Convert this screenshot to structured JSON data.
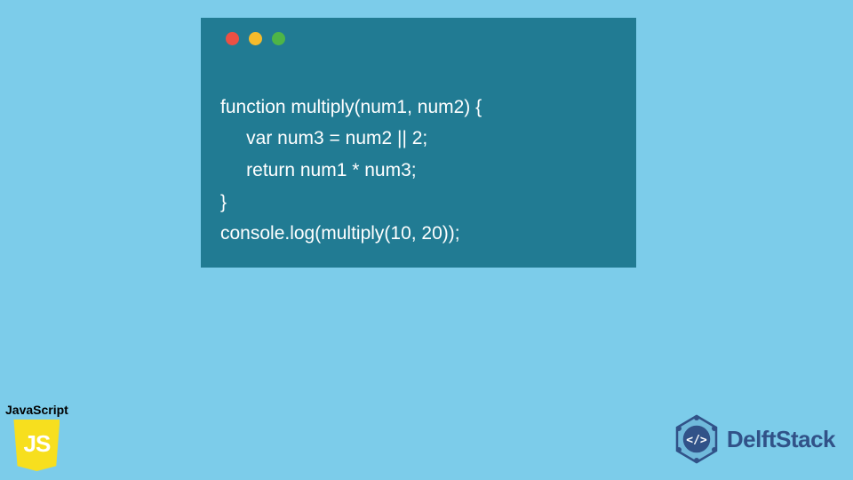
{
  "code": {
    "lines": [
      "function multiply(num1, num2) {",
      "     var num3 = num2 || 2;",
      "     return num1 * num3;",
      "}",
      "console.log(multiply(10, 20));"
    ]
  },
  "jsBadge": {
    "label": "JavaScript",
    "logoText": "JS"
  },
  "brand": {
    "name": "DelftStack"
  },
  "colors": {
    "background": "#7cccea",
    "windowBg": "#217b93",
    "codeText": "#ffffff",
    "dotRed": "#ec5044",
    "dotYellow": "#f6bb2b",
    "dotGreen": "#4eb547",
    "jsYellow": "#f7df1e",
    "brandBlue": "#315288"
  }
}
